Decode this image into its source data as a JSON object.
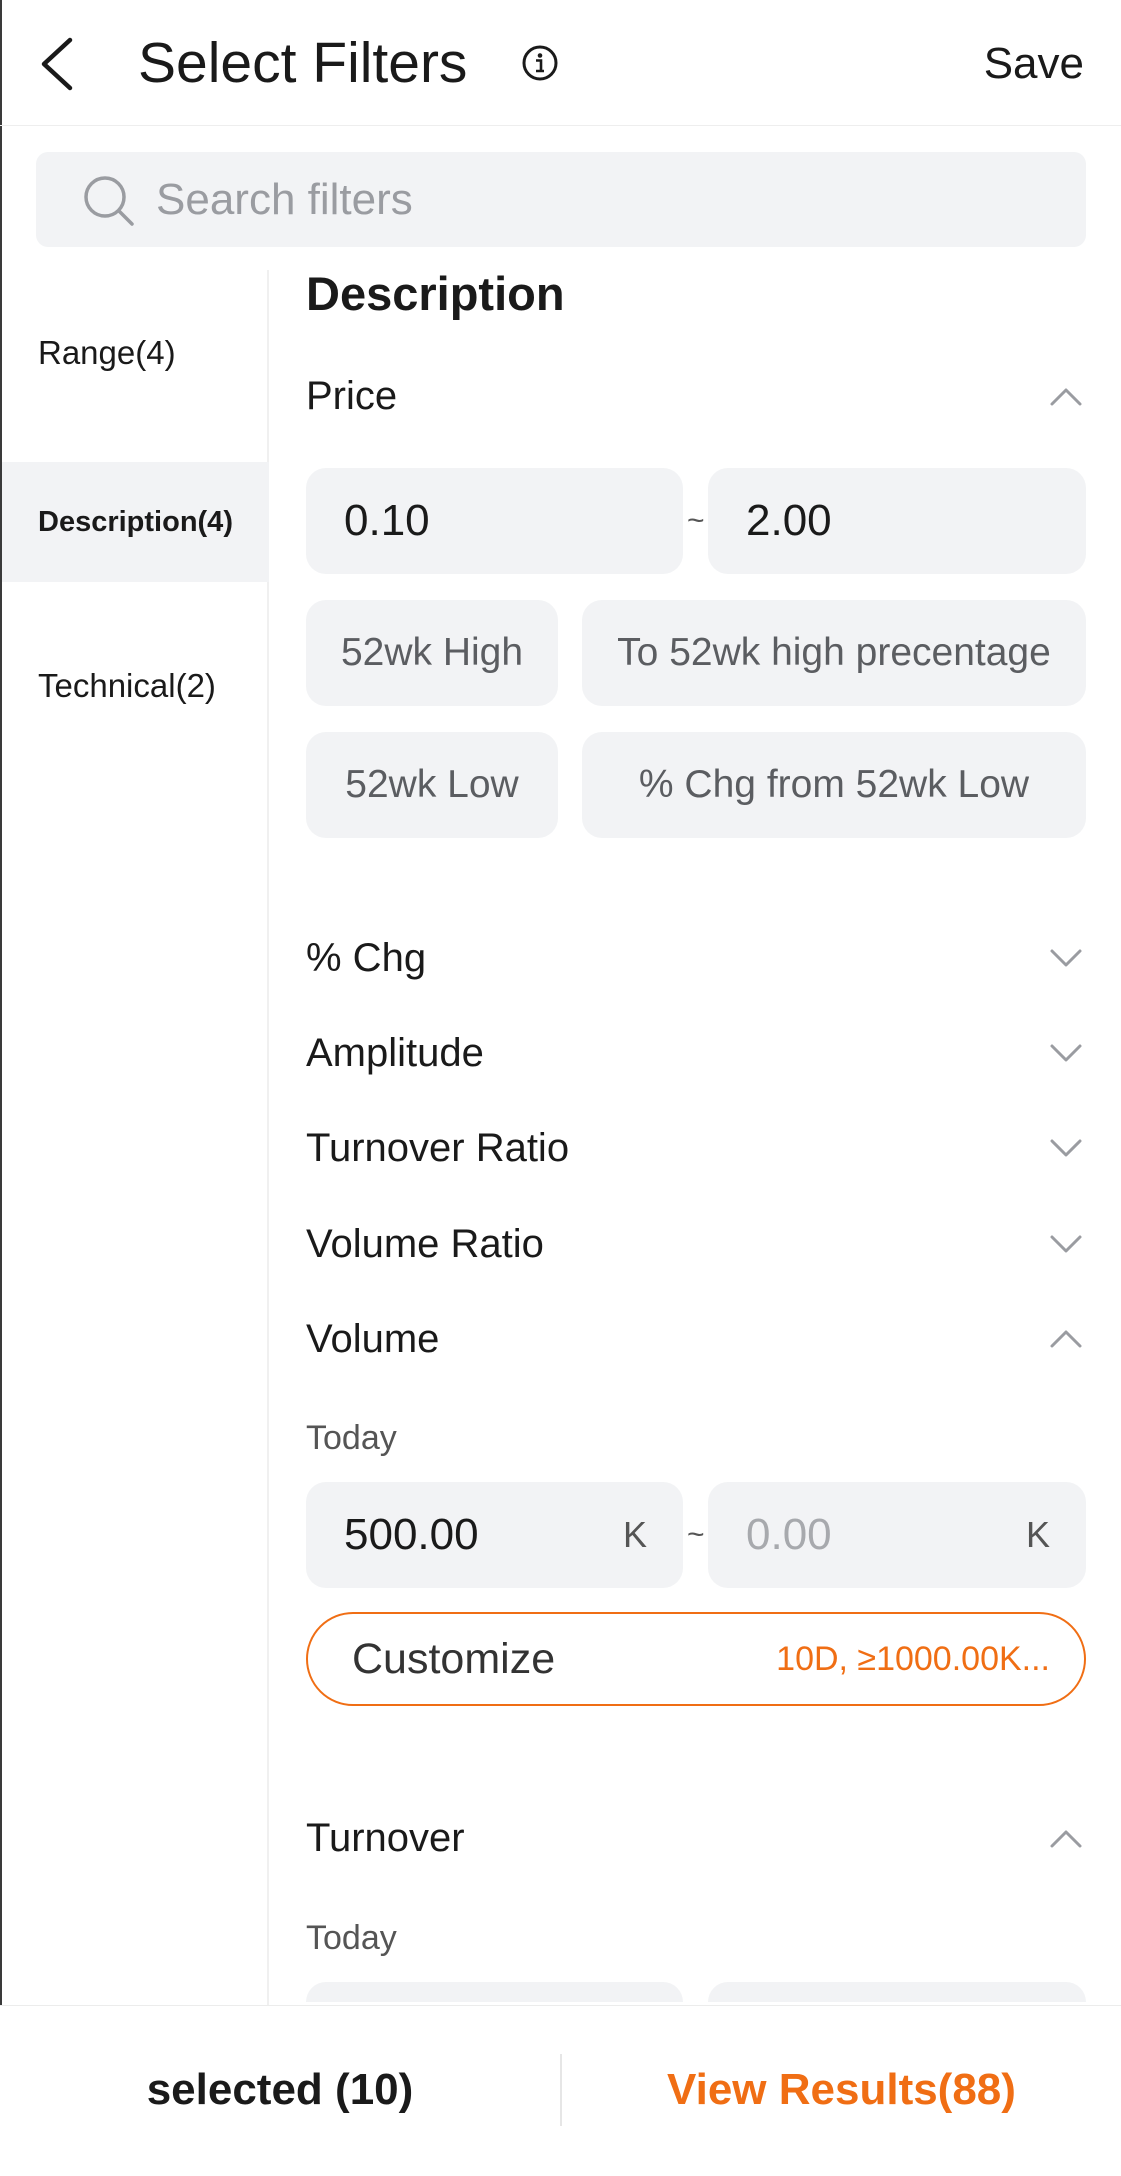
{
  "header": {
    "title": "Select Filters",
    "save_label": "Save"
  },
  "search": {
    "placeholder": "Search filters",
    "value": ""
  },
  "sidebar": {
    "items": [
      {
        "label": "Range(4)",
        "active": false
      },
      {
        "label": "Description(4)",
        "active": true
      },
      {
        "label": "Technical(2)",
        "active": false
      }
    ]
  },
  "main": {
    "section_title": "Description",
    "price": {
      "title": "Price",
      "expanded": true,
      "min": "0.10",
      "max": "2.00",
      "separator": "~",
      "chips": [
        "52wk High",
        "To 52wk high precentage",
        "52wk Low",
        "% Chg from 52wk Low"
      ]
    },
    "collapsed_rows": [
      "% Chg",
      "Amplitude",
      "Turnover Ratio",
      "Volume Ratio"
    ],
    "volume": {
      "title": "Volume",
      "expanded": true,
      "sub_label": "Today",
      "min": "500.00",
      "min_unit": "K",
      "max_placeholder": "0.00",
      "max_unit": "K",
      "separator": "~",
      "customize_label": "Customize",
      "customize_summary": "10D,  ≥1000.00K..."
    },
    "turnover": {
      "title": "Turnover",
      "expanded": true,
      "sub_label": "Today"
    }
  },
  "footer": {
    "selected_label": "selected (10)",
    "view_results_label": "View Results(88)"
  },
  "colors": {
    "accent": "#f06e14",
    "field_bg": "#f2f3f5",
    "text": "#1a1a1a"
  },
  "icons": [
    "chevron-left-icon",
    "info-icon",
    "search-icon",
    "chevron-up-icon",
    "chevron-down-icon"
  ]
}
